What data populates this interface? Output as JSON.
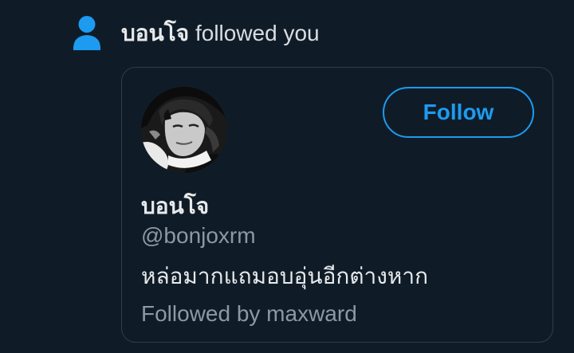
{
  "notification": {
    "name": "บอนโจ",
    "action": " followed you",
    "icon": "person-icon",
    "icon_color": "#1d9bf0"
  },
  "profile_card": {
    "avatar_icon": "profile-photo",
    "follow_label": "Follow",
    "display_name": "บอนโจ",
    "handle": "@bonjoxrm",
    "bio": "หล่อมากแถมอบอุ่นอีกต่างหาก",
    "followed_by": "Followed by maxward"
  },
  "colors": {
    "background": "#0f1c28",
    "accent": "#1d9bf0",
    "text_primary": "#e7e9ea",
    "text_secondary": "#8b98a5",
    "border": "#2f3d4a"
  }
}
